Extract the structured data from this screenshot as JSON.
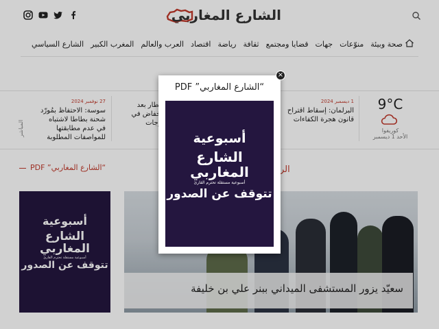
{
  "header": {
    "logo_text": "الشارع المغاربي",
    "social_icons": [
      "instagram-icon",
      "youtube-icon",
      "twitter-icon",
      "facebook-icon"
    ],
    "search_icon": "search-icon"
  },
  "nav": {
    "items": [
      "الشارع السياسي",
      "المغرب الكبير",
      "العرب والعالم",
      "اقتصاد",
      "رياضة",
      "ثقافة",
      "قضايا ومجتمع",
      "جهات",
      "منوّعات",
      "صحة وبيئة"
    ]
  },
  "weather": {
    "temp": "9°C",
    "city": "كوريفوا",
    "date": "الأحد 1 ديسمبر"
  },
  "news": [
    {
      "date": "1 ديسمبر 2024",
      "title": "البرلمان: إسقاط اقتراح قانون هجرة الكفاءات"
    },
    {
      "date": "",
      "title": "أمطار بعد انخفاض في درجات"
    },
    {
      "date": "27 نوفمبر 2024",
      "title": "سوسة: الاحتفاظ بمُورّد شحنة بطاطا لاشتباه في عدم مطابقتها للمواصفات المطلوبة"
    }
  ],
  "ticker_label": "المباشر",
  "sections": {
    "pdf_title": "“الشارع المغاربي” PDF",
    "main_title_partial": "الر"
  },
  "cover": {
    "line1": "أسبوعية",
    "line2": "الشارع",
    "line3": "المغاربي",
    "tagline": "أسبوعية مستقلة تحترم القارئ",
    "headline": "تتوقف عن الصدور"
  },
  "feature": {
    "caption": "سعيّد يزور المستشفى الميداني ببنر علي بن خليفة"
  },
  "popup": {
    "title": "“الشارع المغاربي” PDF",
    "close": "×"
  },
  "colors": {
    "accent": "#c0392b",
    "cover_bg": "#24163f"
  }
}
